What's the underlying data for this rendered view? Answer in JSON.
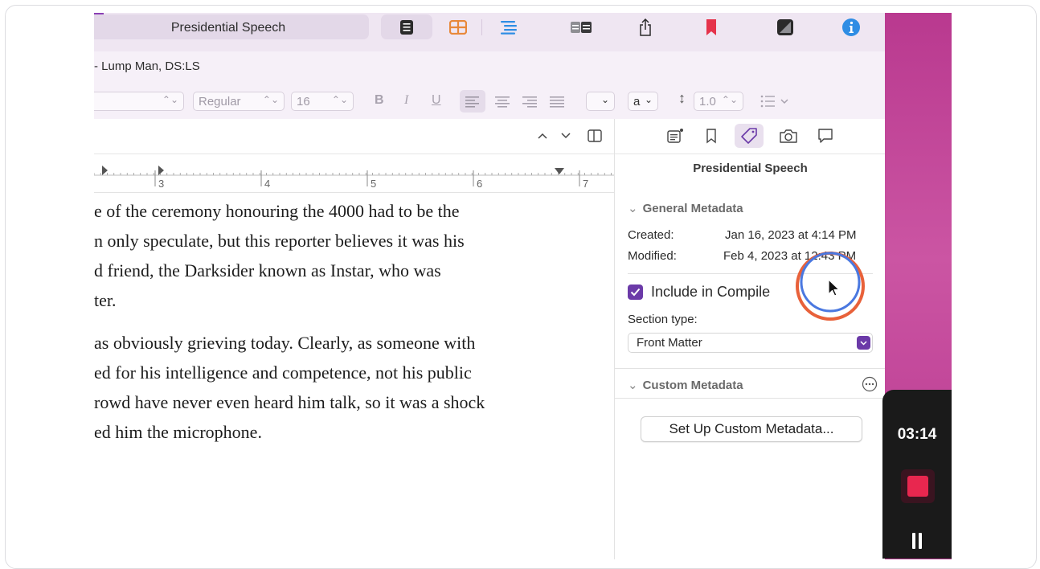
{
  "toolbar": {
    "document_title": "Presidential Speech",
    "icons": [
      "composition-mode-icon",
      "corkboard-icon",
      "outline-icon",
      "compile-icon",
      "share-icon",
      "bookmark-icon",
      "quick-reference-icon",
      "info-icon"
    ],
    "accent_color": "#8a3fb4"
  },
  "subbar": {
    "title": "- Lump Man, DS:LS"
  },
  "format_bar": {
    "font_style": "Regular",
    "font_size": "16",
    "bold_label": "B",
    "italic_label": "I",
    "underline_label": "U",
    "text_color_label": "a",
    "line_spacing": "1.0"
  },
  "ruler": {
    "numbers": [
      "3",
      "4",
      "5",
      "6",
      "7"
    ]
  },
  "editor": {
    "paragraphs": [
      [
        "e of the ceremony honouring the 4000 had to be the",
        "n only speculate, but this reporter believes it was his",
        "d friend, the Darksider known as Instar, who was",
        "ter."
      ],
      [
        "as obviously grieving today. Clearly, as someone with",
        "ed for his intelligence and competence, not his public",
        "rowd have never even heard him talk, so it was a shock",
        "ed him the microphone."
      ]
    ]
  },
  "inspector": {
    "title": "Presidential Speech",
    "general_metadata": {
      "header": "General Metadata",
      "created_label": "Created:",
      "created_value": "Jan 16, 2023 at 4:14 PM",
      "modified_label": "Modified:",
      "modified_value": "Feb 4, 2023 at 12:43 PM"
    },
    "include_in_compile": {
      "label": "Include in Compile",
      "checked": true
    },
    "section_type": {
      "label": "Section type:",
      "value": "Front Matter"
    },
    "custom_metadata": {
      "header": "Custom Metadata",
      "button_label": "Set Up Custom Metadata..."
    }
  },
  "recorder": {
    "elapsed": "03:14",
    "stop_color": "#e8274f"
  }
}
